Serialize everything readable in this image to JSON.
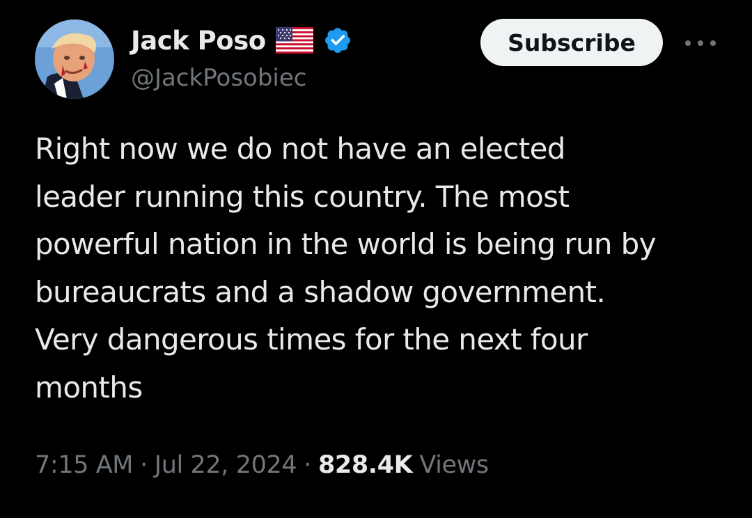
{
  "author": {
    "display_name": "Jack Poso",
    "flag_icon": "us-flag-icon",
    "verified_icon": "verified-badge-icon",
    "verified_color": "#1d9bf0",
    "handle": "@JackPosobiec"
  },
  "actions": {
    "subscribe_label": "Subscribe",
    "more_icon": "more-horizontal-icon"
  },
  "tweet": {
    "lines": [
      "Right now we do not have an elected",
      "leader running this country. The most",
      "powerful nation in the world is being run by",
      "bureaucrats and a shadow government.",
      "Very dangerous times for the next four",
      "months"
    ]
  },
  "meta": {
    "time": "7:15 AM",
    "separator": "·",
    "date": "Jul 22, 2024",
    "views_count": "828.4K",
    "views_label": "Views"
  },
  "colors": {
    "background": "#000000",
    "text_primary": "#e7e9ea",
    "text_secondary": "#71767b",
    "button_bg": "#eff3f4"
  }
}
